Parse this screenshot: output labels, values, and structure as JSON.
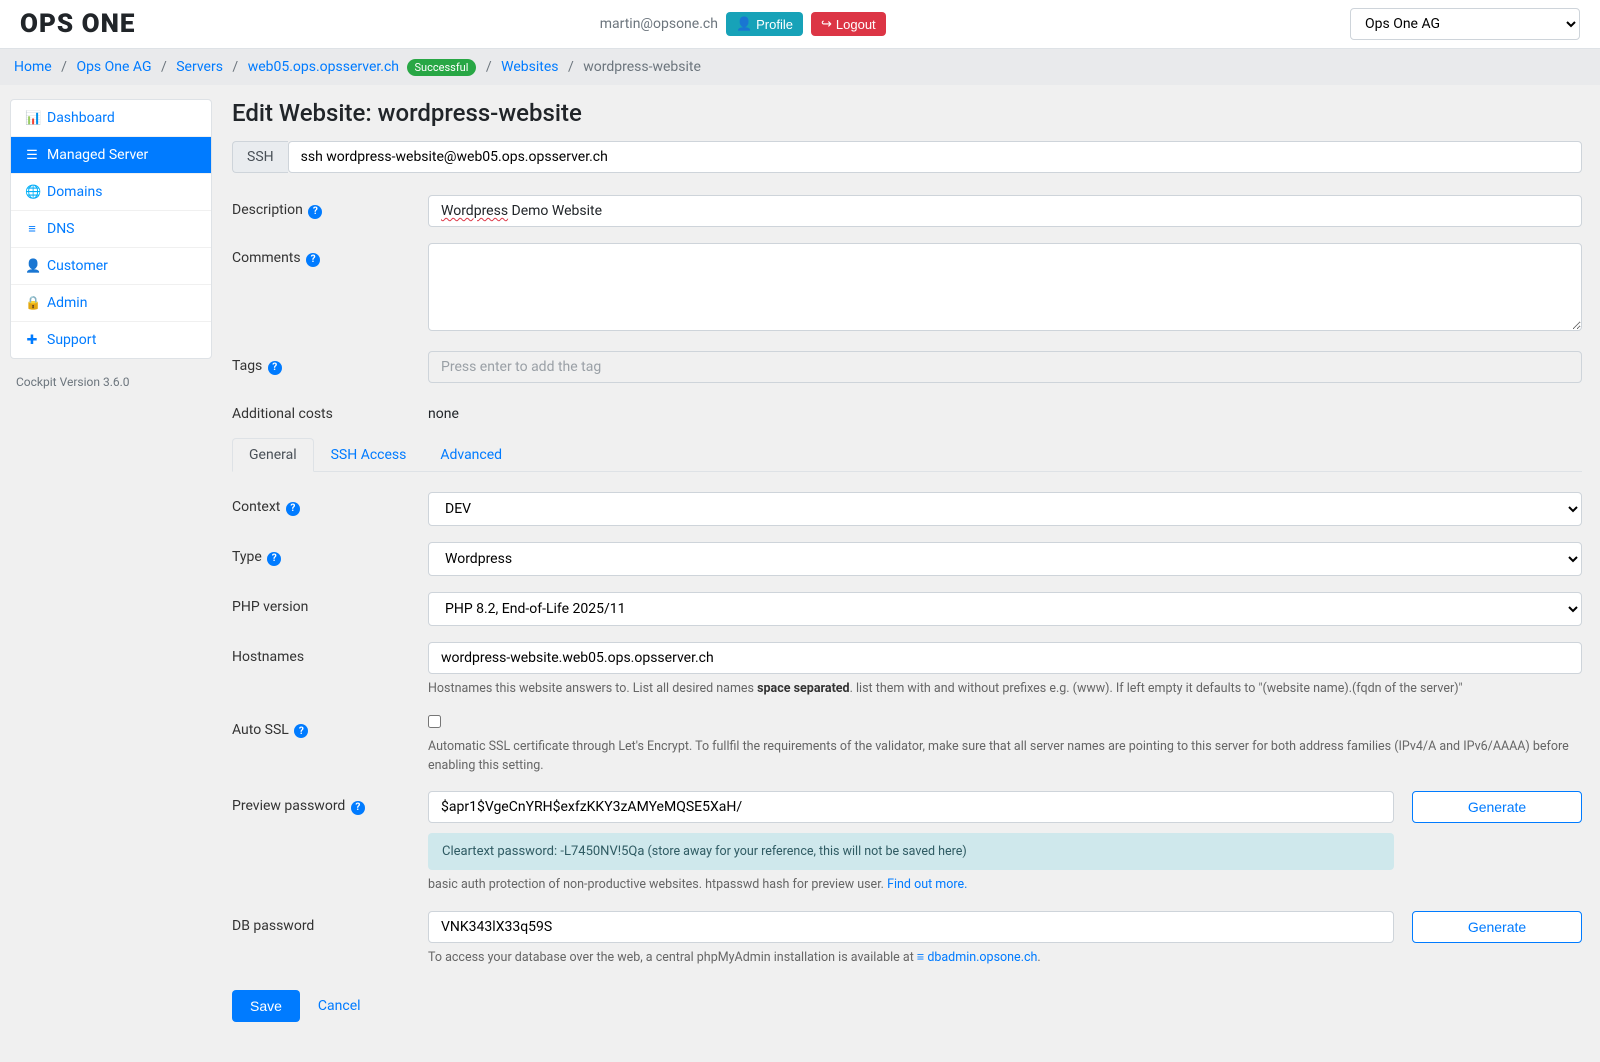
{
  "header": {
    "logo": "OPS ONE",
    "user_email": "martin@opsone.ch",
    "profile_label": "Profile",
    "logout_label": "Logout",
    "org_selected": "Ops One AG"
  },
  "breadcrumb": {
    "home": "Home",
    "org": "Ops One AG",
    "servers": "Servers",
    "server": "web05.ops.opsserver.ch",
    "server_badge": "Successful",
    "websites": "Websites",
    "current": "wordpress-website"
  },
  "sidebar": {
    "items": [
      {
        "label": "Dashboard"
      },
      {
        "label": "Managed Server"
      },
      {
        "label": "Domains"
      },
      {
        "label": "DNS"
      },
      {
        "label": "Customer"
      },
      {
        "label": "Admin"
      },
      {
        "label": "Support"
      }
    ],
    "version": "Cockpit Version 3.6.0"
  },
  "page": {
    "title": "Edit Website: wordpress-website",
    "ssh_label": "SSH",
    "ssh_value": "ssh wordpress-website@web05.ops.opsserver.ch",
    "labels": {
      "description": "Description",
      "comments": "Comments",
      "tags": "Tags",
      "additional_costs": "Additional costs",
      "context": "Context",
      "type": "Type",
      "php_version": "PHP version",
      "hostnames": "Hostnames",
      "auto_ssl": "Auto SSL",
      "preview_password": "Preview password",
      "db_password": "DB password"
    },
    "values": {
      "description_prefix": "Wordpress",
      "description_suffix": " Demo Website",
      "comments": "",
      "tags_placeholder": "Press enter to add the tag",
      "additional_costs": "none",
      "context": "DEV",
      "type": "Wordpress",
      "php_version": "PHP 8.2, End-of-Life 2025/11",
      "hostnames": "wordpress-website.web05.ops.opsserver.ch",
      "preview_password": "$apr1$VgeCnYRH$exfzKKY3zAMYeMQSE5XaH/",
      "db_password": "VNK343lX33q59S"
    },
    "tabs": {
      "general": "General",
      "ssh_access": "SSH Access",
      "advanced": "Advanced"
    },
    "hints": {
      "hostnames_pre": "Hostnames this website answers to. List all desired names ",
      "hostnames_bold": "space separated",
      "hostnames_post": ". list them with and without prefixes e.g. (www). If left empty it defaults to \"(website name).(fqdn of the server)\"",
      "auto_ssl": "Automatic SSL certificate through Let's Encrypt. To fullfil the requirements of the validator, make sure that all server names are pointing to this server for both address families (IPv4/A and IPv6/AAAA) before enabling this setting.",
      "cleartext_label": "Cleartext password: ",
      "cleartext_value": "-L7450NV!5Qa",
      "cleartext_note": " (store away for your reference, this will not be saved here)",
      "preview_help_pre": "basic auth protection of non-productive websites. htpasswd hash for preview user. ",
      "preview_help_link": "Find out more.",
      "db_help_pre": "To access your database over the web, a central phpMyAdmin installation is available at ",
      "db_help_link": "dbadmin.opsone.ch",
      "db_help_post": "."
    },
    "buttons": {
      "generate": "Generate",
      "save": "Save",
      "cancel": "Cancel"
    }
  }
}
